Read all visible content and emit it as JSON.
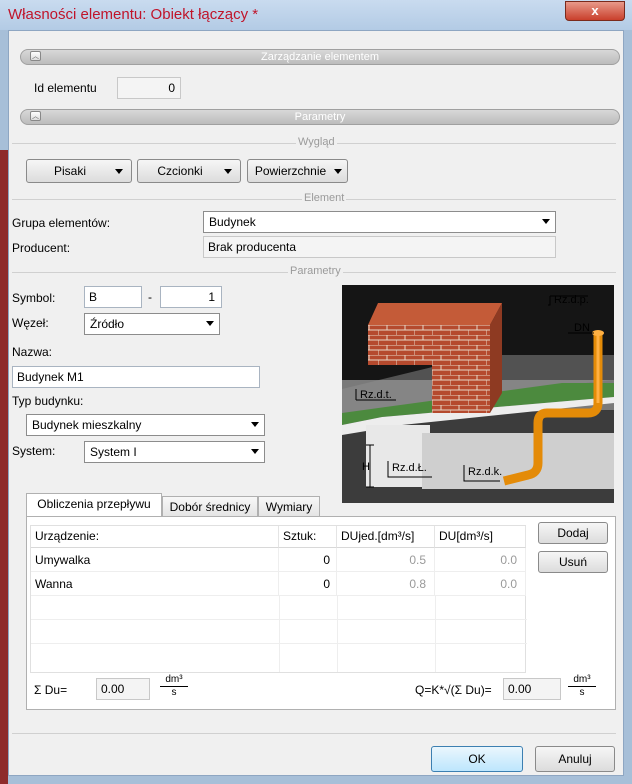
{
  "window": {
    "title": "Własności elementu: Obiekt łączący *",
    "close_glyph": "x"
  },
  "management": {
    "section_label": "Zarządzanie elementem",
    "id_label": "Id elementu",
    "id_value": "0"
  },
  "parameters": {
    "section_label": "Parametry"
  },
  "appearance": {
    "group_label": "Wygląd",
    "pens_label": "Pisaki",
    "fonts_label": "Czcionki",
    "surfaces_label": "Powierzchnie"
  },
  "element": {
    "group_label": "Element",
    "group_field_label": "Grupa elementów:",
    "group_value": "Budynek",
    "producer_label": "Producent:",
    "producer_value": "Brak producenta"
  },
  "params": {
    "group_label": "Parametry",
    "symbol_label": "Symbol:",
    "symbol_prefix": "B",
    "symbol_dash": "-",
    "symbol_number": "1",
    "node_label": "Węzeł:",
    "node_value": "Źródło",
    "name_label": "Nazwa:",
    "name_value": "Budynek M1",
    "building_type_label": "Typ budynku:",
    "building_type_value": "Budynek mieszkalny",
    "system_label": "System:",
    "system_value": "System I"
  },
  "illustration": {
    "labels": {
      "rzdp": "Rz.d.p.",
      "dn": "DN",
      "rzdt": "Rz.d.t.",
      "h": "H",
      "rzdl": "Rz.d.Ł.",
      "rzdk": "Rz.d.k."
    }
  },
  "tabs": [
    {
      "label": "Obliczenia przepływu",
      "active": true
    },
    {
      "label": "Dobór średnicy",
      "active": false
    },
    {
      "label": "Wymiary",
      "active": false
    }
  ],
  "flow_table": {
    "headers": [
      "Urządzenie:",
      "Sztuk:",
      "DUjed.[dm³/s]",
      "DU[dm³/s]"
    ],
    "rows": [
      [
        "Umywalka",
        "0",
        "0.5",
        "0.0"
      ],
      [
        "Wanna",
        "0",
        "0.8",
        "0.0"
      ]
    ],
    "add_label": "Dodaj",
    "remove_label": "Usuń"
  },
  "summary": {
    "sum_label": "Σ Du=",
    "sum_value": "0.00",
    "unit_num": "dm³",
    "unit_den": "s",
    "q_label": "Q=K*√(Σ Du)=",
    "q_value": "0.00"
  },
  "footer": {
    "ok_label": "OK",
    "cancel_label": "Anuluj"
  }
}
